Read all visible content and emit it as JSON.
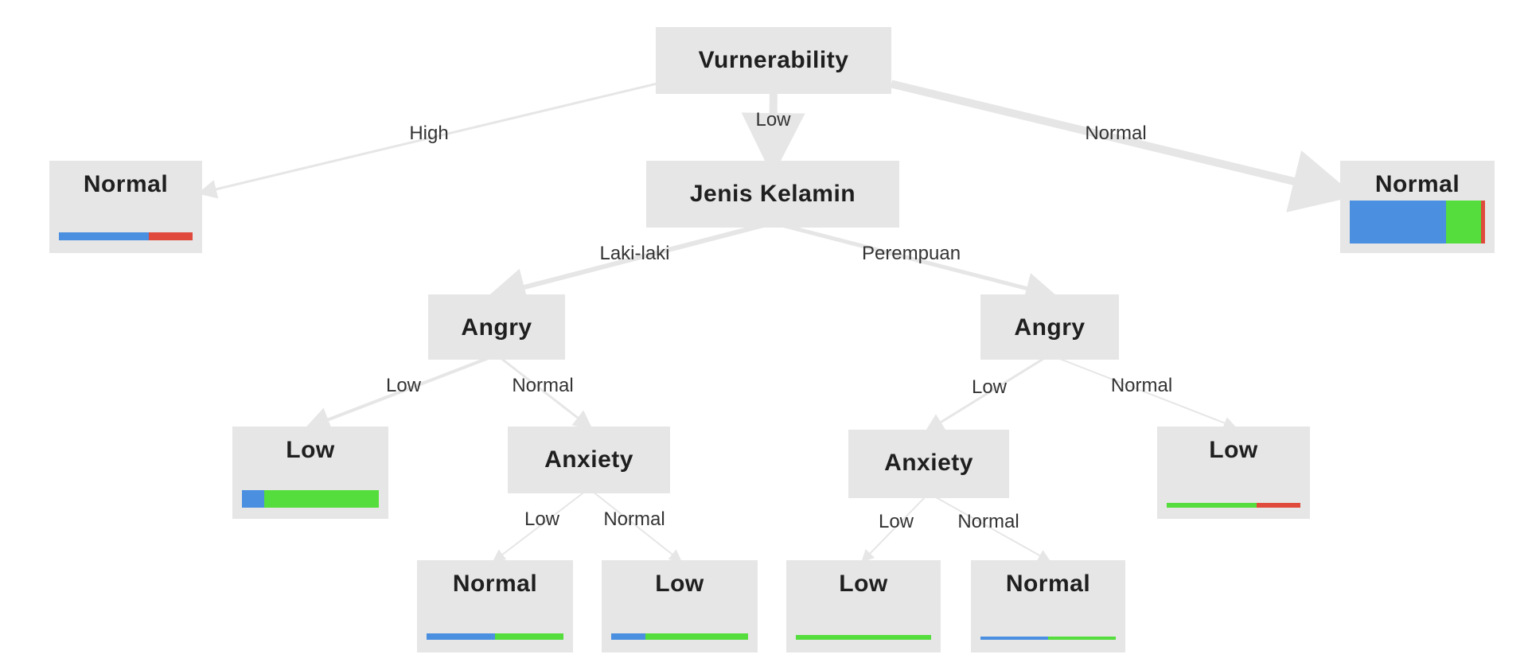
{
  "colors": {
    "blue": "#4a8fe0",
    "green": "#55dd3d",
    "red": "#e04a3d",
    "edge": "#e6e6e6",
    "node_bg": "#e6e6e6"
  },
  "tree": {
    "nodes": [
      {
        "id": "root",
        "label": "Vurnerability",
        "kind": "split"
      },
      {
        "id": "leaf-high",
        "label": "Normal",
        "kind": "leaf",
        "distribution": [
          0.67,
          0.0,
          0.33
        ]
      },
      {
        "id": "jenis-kelamin",
        "label": "Jenis Kelamin",
        "kind": "split"
      },
      {
        "id": "leaf-normal-right",
        "label": "Normal",
        "kind": "leaf",
        "distribution": [
          0.71,
          0.26,
          0.03
        ]
      },
      {
        "id": "angry-left",
        "label": "Angry",
        "kind": "split"
      },
      {
        "id": "angry-right",
        "label": "Angry",
        "kind": "split"
      },
      {
        "id": "leaf-low-1",
        "label": "Low",
        "kind": "leaf",
        "distribution": [
          0.16,
          0.84,
          0.0
        ]
      },
      {
        "id": "anxiety-left",
        "label": "Anxiety",
        "kind": "split"
      },
      {
        "id": "anxiety-right",
        "label": "Anxiety",
        "kind": "split"
      },
      {
        "id": "leaf-low-2",
        "label": "Low",
        "kind": "leaf",
        "distribution": [
          0.0,
          0.67,
          0.33
        ]
      },
      {
        "id": "leaf-normal-3",
        "label": "Normal",
        "kind": "leaf",
        "distribution": [
          0.5,
          0.5,
          0.0
        ]
      },
      {
        "id": "leaf-low-4",
        "label": "Low",
        "kind": "leaf",
        "distribution": [
          0.25,
          0.75,
          0.0
        ]
      },
      {
        "id": "leaf-low-5",
        "label": "Low",
        "kind": "leaf",
        "distribution": [
          0.0,
          1.0,
          0.0
        ]
      },
      {
        "id": "leaf-normal-6",
        "label": "Normal",
        "kind": "leaf",
        "distribution": [
          0.5,
          0.5,
          0.0
        ]
      }
    ],
    "edges": [
      {
        "from": "root",
        "to": "leaf-high",
        "label": "High"
      },
      {
        "from": "root",
        "to": "jenis-kelamin",
        "label": "Low"
      },
      {
        "from": "root",
        "to": "leaf-normal-right",
        "label": "Normal"
      },
      {
        "from": "jenis-kelamin",
        "to": "angry-left",
        "label": "Laki-laki"
      },
      {
        "from": "jenis-kelamin",
        "to": "angry-right",
        "label": "Perempuan"
      },
      {
        "from": "angry-left",
        "to": "leaf-low-1",
        "label": "Low"
      },
      {
        "from": "angry-left",
        "to": "anxiety-left",
        "label": "Normal"
      },
      {
        "from": "angry-right",
        "to": "anxiety-right",
        "label": "Low"
      },
      {
        "from": "angry-right",
        "to": "leaf-low-2",
        "label": "Normal"
      },
      {
        "from": "anxiety-left",
        "to": "leaf-normal-3",
        "label": "Low"
      },
      {
        "from": "anxiety-left",
        "to": "leaf-low-4",
        "label": "Normal"
      },
      {
        "from": "anxiety-right",
        "to": "leaf-low-5",
        "label": "Low"
      },
      {
        "from": "anxiety-right",
        "to": "leaf-normal-6",
        "label": "Normal"
      }
    ]
  }
}
